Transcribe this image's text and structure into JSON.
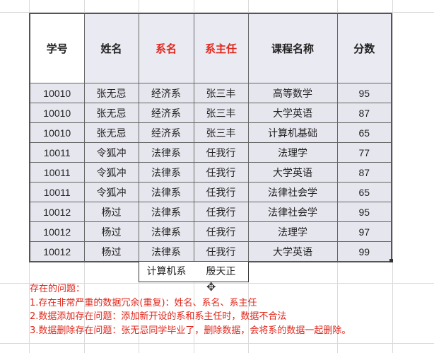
{
  "table": {
    "headers": [
      "学号",
      "姓名",
      "系名",
      "系主任",
      "课程名称",
      "分数"
    ],
    "rows": [
      [
        "10010",
        "张无忌",
        "经济系",
        "张三丰",
        "高等数学",
        "95"
      ],
      [
        "10010",
        "张无忌",
        "经济系",
        "张三丰",
        "大学英语",
        "87"
      ],
      [
        "10010",
        "张无忌",
        "经济系",
        "张三丰",
        "计算机基础",
        "65"
      ],
      [
        "10011",
        "令狐冲",
        "法律系",
        "任我行",
        "法理学",
        "77"
      ],
      [
        "10011",
        "令狐冲",
        "法律系",
        "任我行",
        "大学英语",
        "87"
      ],
      [
        "10011",
        "令狐冲",
        "法律系",
        "任我行",
        "法律社会学",
        "65"
      ],
      [
        "10012",
        "杨过",
        "法律系",
        "任我行",
        "法律社会学",
        "95"
      ],
      [
        "10012",
        "杨过",
        "法律系",
        "任我行",
        "法理学",
        "97"
      ],
      [
        "10012",
        "杨过",
        "法律系",
        "任我行",
        "大学英语",
        "99"
      ]
    ],
    "extra_row": {
      "dept": "计算机系",
      "head": "殷天正"
    }
  },
  "notes": [
    "存在的问题：",
    "1.存在非常严重的数据冗余(重复)：姓名、系名、系主任",
    "2.数据添加存在问题：添加新开设的系和系主任时，数据不合法",
    "3.数据删除存在问题：张无忌同学毕业了，删除数据，会将系的数据一起删除。"
  ],
  "colors": {
    "highlight": "#e0261b"
  }
}
